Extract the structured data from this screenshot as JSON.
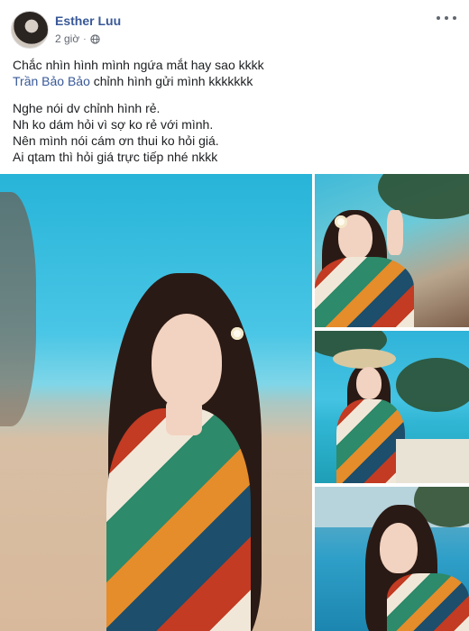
{
  "post": {
    "author_name": "Esther Luu",
    "time": "2 giờ",
    "separator": "·",
    "privacy": "globe-icon",
    "more_menu": "more-icon"
  },
  "content": {
    "line1": "Chắc nhìn hình mình ngứa mắt hay sao kkkk",
    "mention_name": "Trần Bảo Bảo",
    "line2_rest": " chỉnh hình gửi mình kkkkkkk",
    "line3": "Nghe nói dv chỉnh hình rẻ.",
    "line4": "Nh ko dám hỏi vì sợ ko rẻ với mình.",
    "line5": "Nên mình nói cám ơn thui ko hỏi giá.",
    "line6": "Ai qtam thì hỏi giá trực tiếp nhé nkkk"
  },
  "colors": {
    "link": "#385898",
    "text": "#1c1e21",
    "meta": "#616770"
  }
}
